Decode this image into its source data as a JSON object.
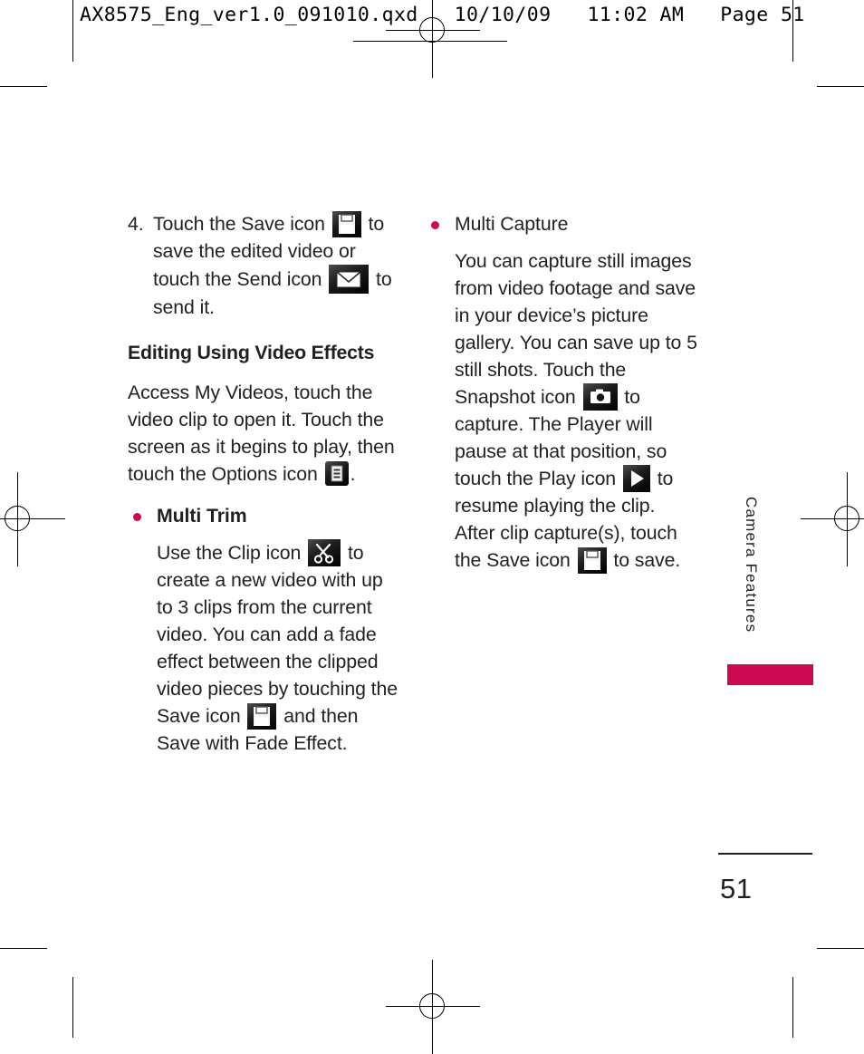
{
  "prepress": {
    "slug": "AX8575_Eng_ver1.0_091010.qxd   10/10/09   11:02 AM   Page 51"
  },
  "colors": {
    "accent": "#cc0a52",
    "text": "#231f20"
  },
  "left_column": {
    "step": {
      "number": "4.",
      "text_before_save_icon": "Touch the Save icon",
      "text_after_save_icon": "to save the edited video or touch the Send icon",
      "text_after_send_icon": "to send it.",
      "save_icon": "save-floppy-icon",
      "send_icon": "send-envelope-icon"
    },
    "subhead": "Editing Using Video Effects",
    "intro_before_icon": "Access My Videos, touch the video clip to open it. Touch the screen as it begins to play, then touch the Options icon",
    "intro_after_icon": ".",
    "options_icon": "options-list-icon",
    "bullet": {
      "label": "Multi Trim",
      "text_before_clip_icon": "Use the Clip icon",
      "text_after_clip_icon": "to create a new video with up to 3 clips from the current video. You can add a fade effect between the clipped video pieces by touching the Save icon",
      "text_after_save_icon": "and then Save with Fade Effect.",
      "clip_icon": "clip-scissors-icon",
      "save_icon": "save-floppy-icon"
    }
  },
  "right_column": {
    "bullet": {
      "label": "Multi Capture",
      "text_before_snapshot_icon": "You can capture still images from video footage and save in your device’s picture gallery. You can save up to 5 still shots. Touch the Snapshot icon",
      "text_after_snapshot_icon": "to capture. The Player will pause at that position, so touch the Play icon",
      "text_after_play_icon": "to resume playing the clip. After clip capture(s), touch the Save icon",
      "text_after_save_icon": "to save.",
      "snapshot_icon": "snapshot-camera-icon",
      "play_icon": "play-triangle-icon",
      "save_icon": "save-floppy-icon"
    }
  },
  "side_tab": {
    "label": "Camera Features"
  },
  "folio": {
    "page_number": "51"
  }
}
